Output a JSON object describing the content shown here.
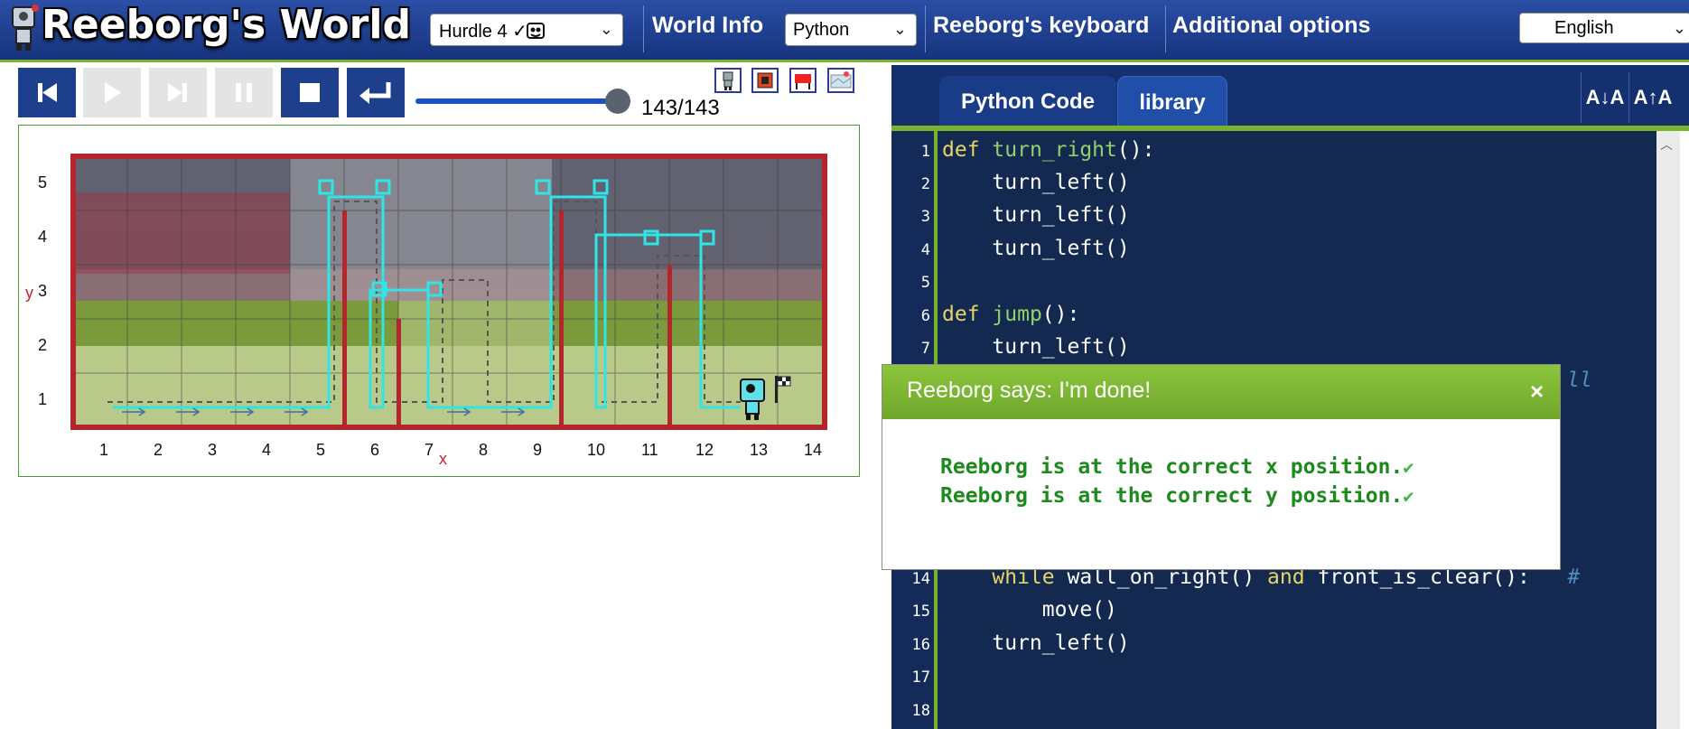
{
  "header": {
    "app_title": "Reeborg's World",
    "world_select": "Hurdle 4 ✓",
    "world_info": "World Info",
    "language_select": "Python",
    "keyboard": "Reeborg's keyboard",
    "additional_options": "Additional options",
    "ui_language_select": "English"
  },
  "controls": {
    "buttons": [
      "reload",
      "run",
      "step",
      "pause",
      "stop",
      "return"
    ],
    "step_counter": "143/143",
    "progress_fraction": 1.0
  },
  "world": {
    "x_axis_labels": [
      "1",
      "2",
      "3",
      "4",
      "5",
      "6",
      "7",
      "8",
      "9",
      "10",
      "11",
      "12",
      "13",
      "14"
    ],
    "y_axis_labels": [
      "1",
      "2",
      "3",
      "4",
      "5"
    ],
    "x_axis_title": "x",
    "y_axis_title": "y"
  },
  "editor": {
    "tabs": [
      "Python Code",
      "library"
    ],
    "font_decrease": "A↓A",
    "font_increase": "A↑A",
    "visible_lines": [
      {
        "n": "1",
        "text": "def turn_right():"
      },
      {
        "n": "2",
        "text": "    turn_left()"
      },
      {
        "n": "3",
        "text": "    turn_left()"
      },
      {
        "n": "4",
        "text": "    turn_left()"
      },
      {
        "n": "5",
        "text": ""
      },
      {
        "n": "6",
        "text": "def jump():"
      },
      {
        "n": "7",
        "text": "    turn_left()"
      },
      {
        "n": "14",
        "text": "    while wall_on_right() and front_is_clear():   #"
      },
      {
        "n": "15",
        "text": "        move()"
      },
      {
        "n": "16",
        "text": "    turn_left()"
      },
      {
        "n": "17",
        "text": ""
      },
      {
        "n": "18",
        "text": ""
      }
    ],
    "partial_comment_line8": "ll"
  },
  "dialog": {
    "title": "Reeborg says: I'm done!",
    "close": "×",
    "messages": [
      "Reeborg is at the correct x position.",
      "Reeborg is at the correct y position."
    ],
    "check_mark": "✔"
  },
  "colors": {
    "header_bg": "#1e3f8c",
    "accent_green": "#79b32b",
    "editor_bg": "#13294f",
    "wall_red": "#b3262c",
    "trace_cyan": "#2ee6e6",
    "message_green": "#1d8a1d"
  }
}
